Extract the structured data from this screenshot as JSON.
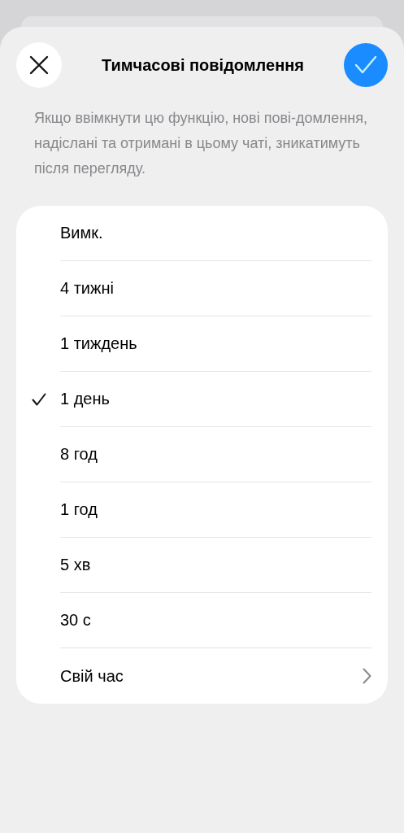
{
  "header": {
    "title": "Тимчасові повідомлення"
  },
  "description": "Якщо ввімкнути цю функцію, нові пові-домлення, надіслані та отримані в цьому чаті, зникатимуть після перегляду.",
  "options": [
    {
      "label": "Вимк.",
      "kind": "option",
      "selected": false
    },
    {
      "label": "4 тижні",
      "kind": "option",
      "selected": false
    },
    {
      "label": "1 тиждень",
      "kind": "option",
      "selected": false
    },
    {
      "label": "1 день",
      "kind": "option",
      "selected": true
    },
    {
      "label": "8 год",
      "kind": "option",
      "selected": false
    },
    {
      "label": "1 год",
      "kind": "option",
      "selected": false
    },
    {
      "label": "5 хв",
      "kind": "option",
      "selected": false
    },
    {
      "label": "30 с",
      "kind": "option",
      "selected": false
    },
    {
      "label": "Свій час",
      "kind": "disclosure",
      "selected": false
    }
  ]
}
